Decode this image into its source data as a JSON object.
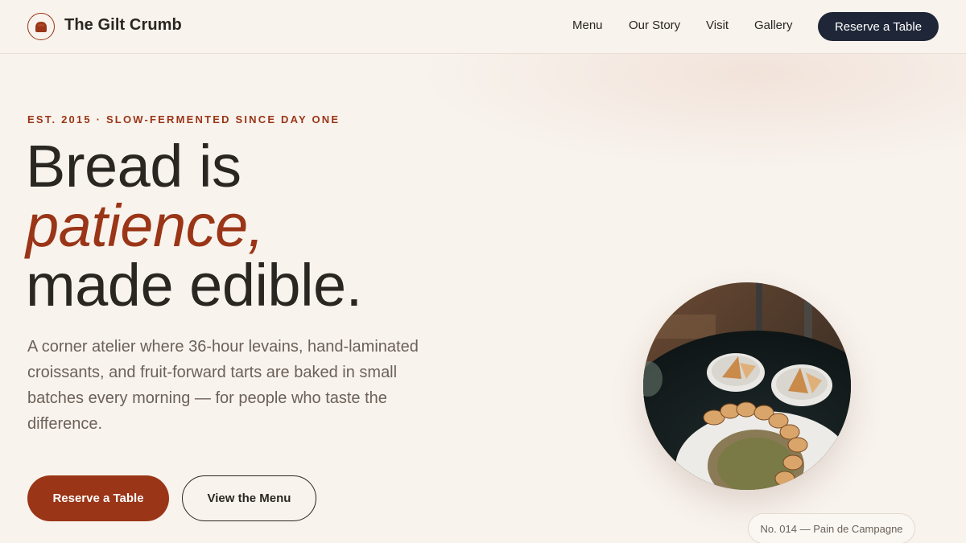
{
  "header": {
    "brand": "The Gilt Crumb",
    "logo_icon": "bread-loaf-icon",
    "nav": [
      {
        "label": "Menu"
      },
      {
        "label": "Our Story"
      },
      {
        "label": "Visit"
      },
      {
        "label": "Gallery"
      }
    ],
    "cta": "Reserve a Table"
  },
  "hero": {
    "eyebrow": "EST. 2015 · SLOW-FERMENTED SINCE DAY ONE",
    "headline_line1": "Bread is",
    "headline_accent": "patience,",
    "headline_line3": "made edible.",
    "lead": "A corner atelier where 36-hour levains, hand-laminated croissants, and fruit-forward tarts are baked in small batches every morning — for people who taste the difference.",
    "primary_button": "Reserve a Table",
    "secondary_button": "View the Menu"
  },
  "feature": {
    "caption": "No. 014 — Pain de Campagne"
  },
  "colors": {
    "background": "#f8f3ed",
    "accent": "#9a3517",
    "nav_cta": "#1f2637",
    "text": "#2a2622",
    "muted": "#6b6158"
  }
}
